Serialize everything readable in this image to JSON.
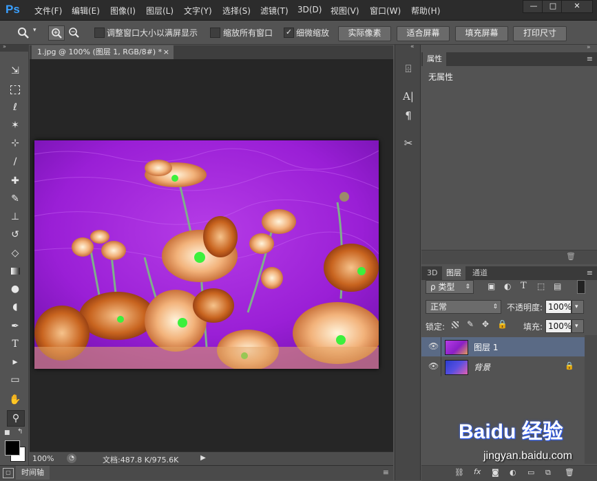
{
  "app": {
    "logo": "Ps"
  },
  "menu": [
    "文件(F)",
    "编辑(E)",
    "图像(I)",
    "图层(L)",
    "文字(Y)",
    "选择(S)",
    "滤镜(T)",
    "3D(D)",
    "视图(V)",
    "窗口(W)",
    "帮助(H)"
  ],
  "window_controls": {
    "minimize": "—",
    "restore": "□",
    "close": "✕"
  },
  "options": {
    "chk_resize_window": "调整窗口大小以满屏显示",
    "chk_zoom_all": "缩放所有窗口",
    "chk_scrubby": "细微缩放",
    "btn_actual": "实际像素",
    "btn_fit": "适合屏幕",
    "btn_fill": "填充屏幕",
    "btn_print": "打印尺寸"
  },
  "document": {
    "tab_title": "1.jpg @ 100% (图层 1, RGB/8#) *",
    "zoom": "100%",
    "doc_info": "文档:487.8 K/975.6K"
  },
  "timeline": {
    "label": "时间轴"
  },
  "properties": {
    "tab": "属性",
    "content": "无属性"
  },
  "layers_panel": {
    "tabs": [
      "3D",
      "图层",
      "通道"
    ],
    "filter_kind": "ρ 类型",
    "blend_mode": "正常",
    "opacity_label": "不透明度:",
    "opacity_value": "100%",
    "lock_label": "锁定:",
    "fill_label": "填充:",
    "fill_value": "100%",
    "layers": [
      {
        "name": "图层 1",
        "selected": true
      },
      {
        "name": "背景",
        "locked": true
      }
    ]
  },
  "watermark": {
    "brand": "Baidu 经验",
    "url": "jingyan.baidu.com"
  },
  "colors": {
    "accent": "#3aa0ff",
    "selected_layer": "#5a6a85",
    "canvas_bg": "#262626"
  }
}
